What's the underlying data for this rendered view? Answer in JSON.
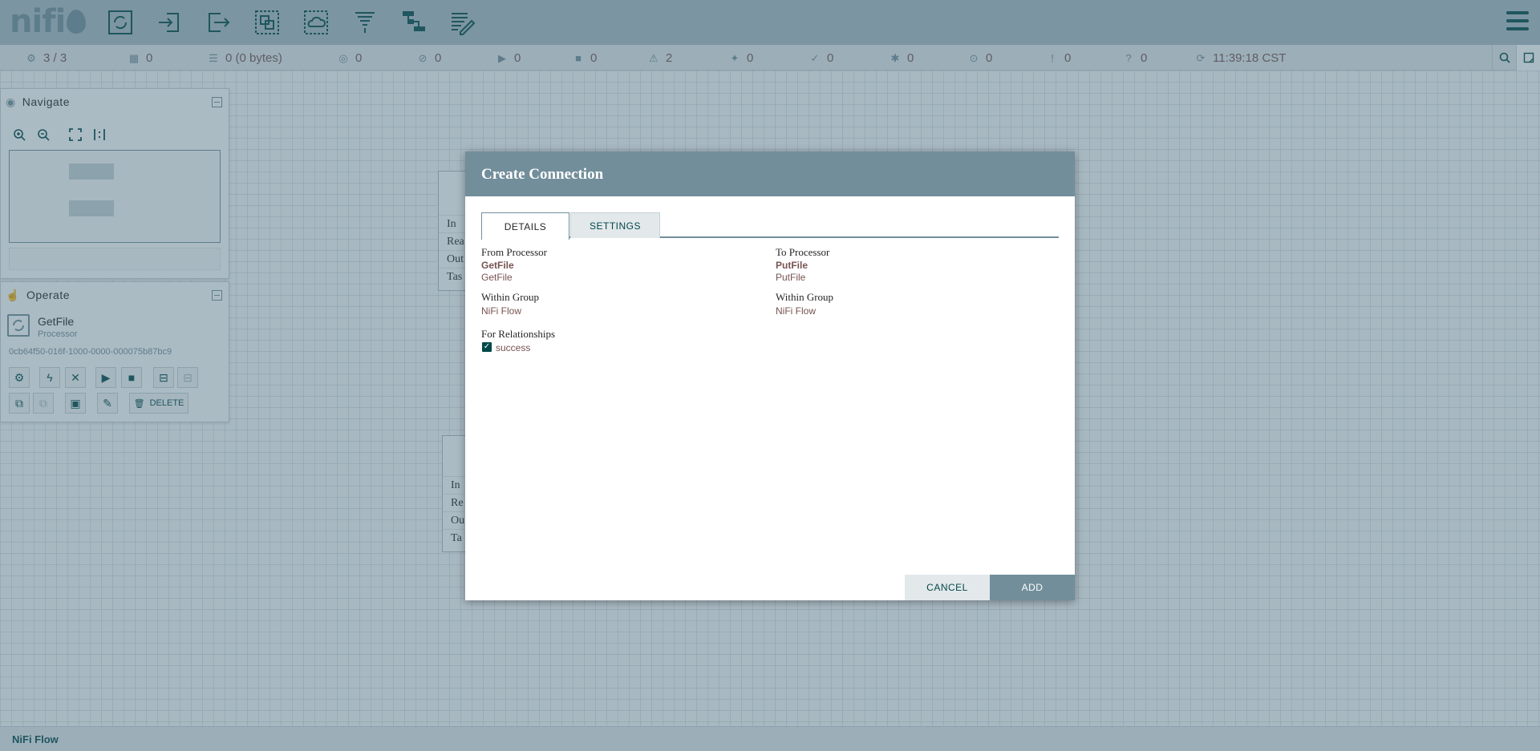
{
  "header": {
    "logo_text": "nifi",
    "toolbar_icons": [
      "processor-icon",
      "input-port-icon",
      "output-port-icon",
      "process-group-icon",
      "remote-process-group-icon",
      "funnel-icon",
      "template-icon",
      "label-icon"
    ]
  },
  "status": {
    "threads": "3 / 3",
    "tasks": "0",
    "queued": "0 (0 bytes)",
    "transmitting": "0",
    "not_transmitting": "0",
    "running": "0",
    "stopped": "0",
    "invalid": "2",
    "disabled": "0",
    "up_to_date": "0",
    "locally_modified": "0",
    "stale": "0",
    "locally_modified_stale": "0",
    "sync_failure": "0",
    "refreshed": "11:39:18 CST"
  },
  "navigate": {
    "title": "Navigate"
  },
  "operate": {
    "title": "Operate",
    "component_name": "GetFile",
    "component_type": "Processor",
    "component_id": "0cb64f50-016f-1000-0000-000075b87bc9",
    "delete_label": "DELETE"
  },
  "canvas": {
    "proc1_rows": [
      "In",
      "Rea",
      "Out",
      "Tas"
    ],
    "proc2_rows": [
      "In",
      "Re",
      "Ou",
      "Ta"
    ]
  },
  "dialog": {
    "title": "Create Connection",
    "tabs": {
      "details": "DETAILS",
      "settings": "SETTINGS"
    },
    "from_processor_label": "From Processor",
    "from_processor_name": "GetFile",
    "from_processor_type": "GetFile",
    "from_group_label": "Within Group",
    "from_group_value": "NiFi Flow",
    "to_processor_label": "To Processor",
    "to_processor_name": "PutFile",
    "to_processor_type": "PutFile",
    "to_group_label": "Within Group",
    "to_group_value": "NiFi Flow",
    "relationships_label": "For Relationships",
    "relationship_success": "success",
    "cancel": "CANCEL",
    "add": "ADD"
  },
  "footer": {
    "breadcrumb": "NiFi Flow"
  }
}
